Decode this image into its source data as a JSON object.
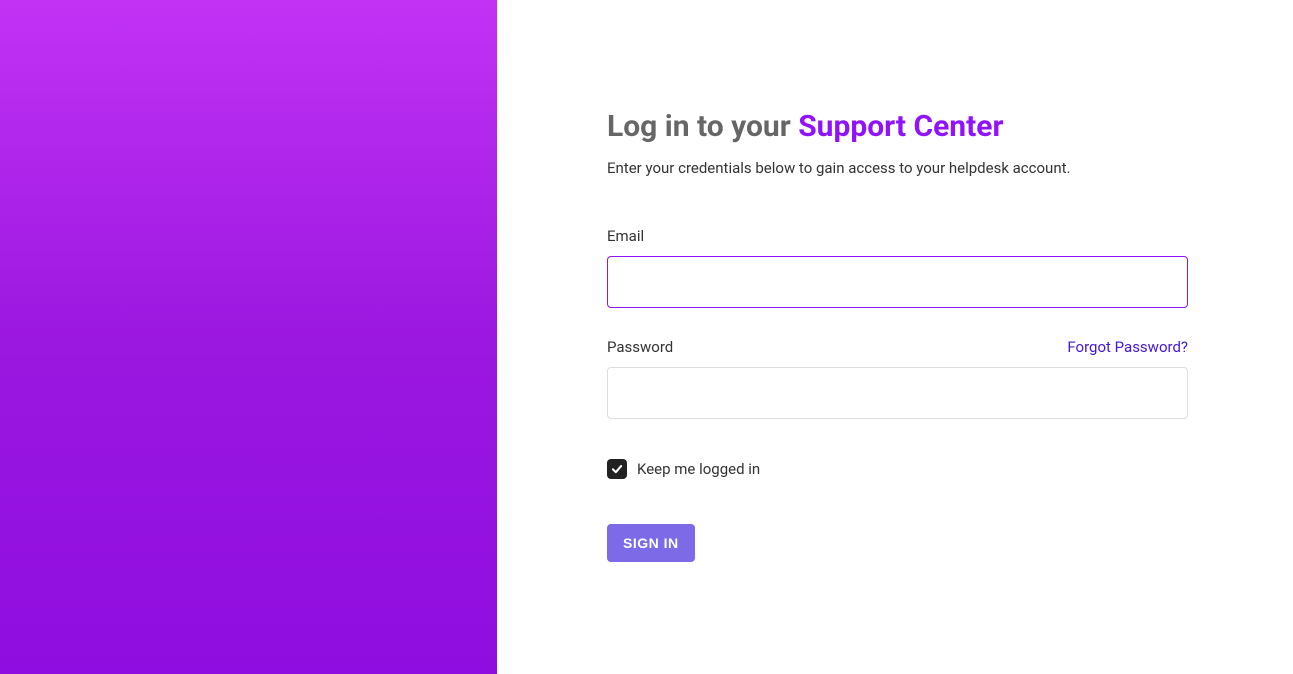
{
  "title_prefix": "Log in to your ",
  "title_accent": "Support Center",
  "subtitle": "Enter your credentials below to gain access to your helpdesk account.",
  "email": {
    "label": "Email",
    "value": ""
  },
  "password": {
    "label": "Password",
    "forgot_label": "Forgot Password?",
    "value": ""
  },
  "remember": {
    "label": "Keep me logged in",
    "checked": true
  },
  "signin_label": "SIGN IN"
}
